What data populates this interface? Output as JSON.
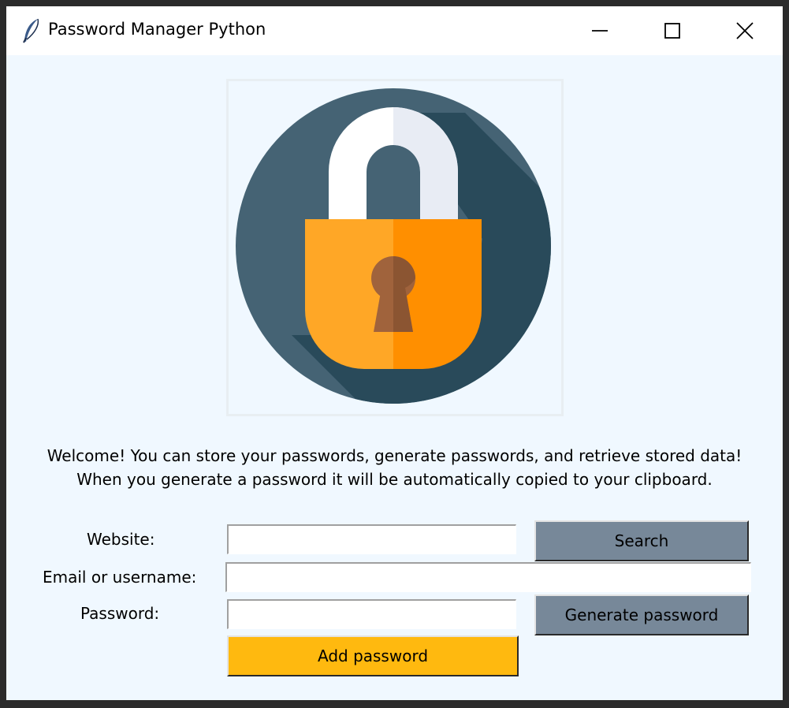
{
  "window": {
    "title": "Password Manager Python"
  },
  "icons": {
    "app": "feather-icon",
    "logo": "padlock-icon",
    "minimize": "minimize-icon",
    "maximize": "maximize-icon",
    "close": "close-icon"
  },
  "welcome": {
    "line1": "Welcome! You can store your passwords, generate passwords, and retrieve stored data!",
    "line2": "When you generate a password it will be automatically copied to your clipboard."
  },
  "form": {
    "website_label": "Website:",
    "website_value": "",
    "email_label": "Email or username:",
    "email_value": "",
    "password_label": "Password:",
    "password_value": ""
  },
  "buttons": {
    "search": "Search",
    "generate_password": "Generate password",
    "add_password": "Add password"
  },
  "colors": {
    "window_bg": "#f0f8ff",
    "button_gray": "#778899",
    "button_add": "#ffb90f",
    "logo_circle": "#456374",
    "logo_shadow": "#294a5a",
    "lock_body_left": "#ffa726",
    "lock_body_right": "#ff8f00",
    "keyhole": "#a0633c"
  }
}
